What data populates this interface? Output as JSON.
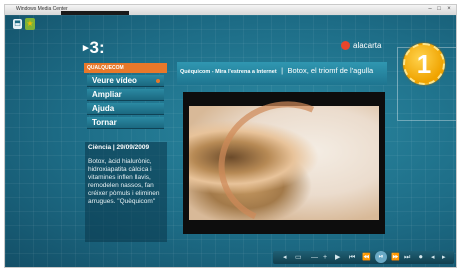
{
  "window": {
    "title": "Windows Media Center"
  },
  "topicons": {
    "icon1": "⬒",
    "icon2": "★"
  },
  "brand": {
    "logo": "3:",
    "logo_arrow": "▸",
    "alacarta": "alacarta"
  },
  "badge": {
    "number": "1"
  },
  "menu": {
    "header": "QUALQUECOM",
    "items": [
      {
        "label": "Veure vídeo"
      },
      {
        "label": "Ampliar"
      },
      {
        "label": "Ajuda"
      },
      {
        "label": "Tornar"
      }
    ]
  },
  "info": {
    "heading": "Ciència | 29/09/2009",
    "body": "Botox, àcid hialurònic, hidroxiapatita càlcica i vitamines inflen llavis, remodelen nassos, fan créixer pòmuls i eliminen arrugues. \"Quèquicom\""
  },
  "video_title": {
    "program": "Quèquicom - Mira l'estrena a Internet",
    "separator": "|",
    "headline": "Botox, el triomf de l'agulla"
  },
  "controls": {
    "buttons": [
      "◂",
      "▭",
      "—",
      "+",
      "▶",
      "⏮",
      "⏪",
      "⏯",
      "⏩",
      "⏭",
      "⏺",
      "◂",
      "▸"
    ]
  },
  "colors": {
    "accent_orange": "#e8782a",
    "background_teal": "#1c6a82",
    "badge_gold": "#f0a300",
    "alacarta_red": "#e8452b"
  }
}
